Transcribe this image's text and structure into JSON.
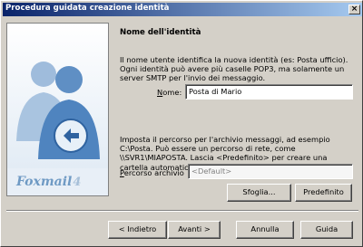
{
  "window": {
    "title": "Procedura guidata creazione identità",
    "close_glyph": "×"
  },
  "banner": {
    "logo_name": "Foxmail",
    "logo_version": "4"
  },
  "section": {
    "heading": "Nome dell'identità",
    "description": "Il nome utente identifica la nuova identità (es: Posta ufficio). Ogni identità può avere più caselle POP3, ma solamente un server SMTP per l'invio dei messaggio.",
    "name_label_accel": "N",
    "name_label_rest": "ome:",
    "name_value": "Posta di Mario",
    "archive_description": "Imposta il percorso per l'archivio messaggi, ad esempio C:\\Posta. Può essere un percorso di rete, come \\\\SVR1\\MIAPOSTA. Lascia <Predefinito> per creare una cartella automaticamente.",
    "path_label_accel": "P",
    "path_label_rest": "ercorso archivio",
    "path_value": "<Default>"
  },
  "buttons": {
    "browse": "Sfoglia...",
    "default": "Predefinito",
    "back": "< Indietro",
    "next": "Avanti >",
    "cancel": "Annulla",
    "help": "Guida"
  }
}
